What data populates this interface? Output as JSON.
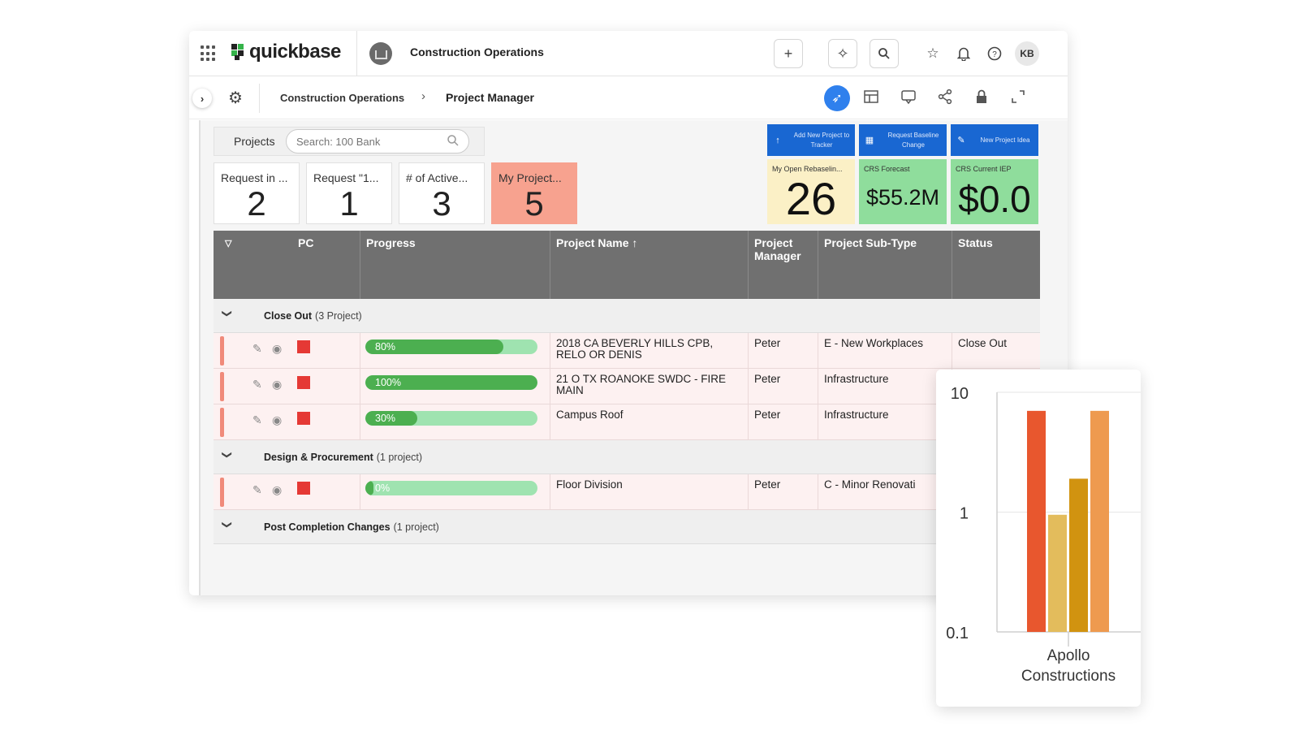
{
  "topbar": {
    "logo_text": "quickbase",
    "app_name": "Construction Operations",
    "user_initials": "KB",
    "icons": [
      "apps-grid-icon",
      "plus-icon",
      "ai-sparkle-icon",
      "search-icon",
      "star-icon",
      "bell-icon",
      "help-icon"
    ]
  },
  "subbar": {
    "breadcrumb_app": "Construction Operations",
    "breadcrumb_separator": "›",
    "breadcrumb_page": "Project Manager"
  },
  "search": {
    "tab_label": "Projects",
    "placeholder": "Search: 100 Bank"
  },
  "kpis": [
    {
      "label": "Request in ...",
      "value": "2"
    },
    {
      "label": "Request \"1...",
      "value": "1"
    },
    {
      "label": "# of Active...",
      "value": "3"
    },
    {
      "label": "My Project...",
      "value": "5",
      "highlight": "#f7a28f"
    }
  ],
  "actions": [
    {
      "label": "Add New Project to Tracker",
      "icon": "arrow-up-icon"
    },
    {
      "label": "Request Baseline Change",
      "icon": "table-icon"
    },
    {
      "label": "New Project Idea",
      "icon": "lightbulb-icon"
    }
  ],
  "metrics": [
    {
      "label": "My Open Rebaselin...",
      "value": "26",
      "color": "#fbf0c6"
    },
    {
      "label": "CRS Forecast",
      "value": "$55.2M",
      "color": "#8fdd9c"
    },
    {
      "label": "CRS Current IEP",
      "value": "$0.0",
      "color": "#8fdd9c"
    }
  ],
  "table": {
    "columns": [
      "PC",
      "Progress",
      "Project Name ↑",
      "Project Manager",
      "Project Sub-Type",
      "Status"
    ],
    "groups": [
      {
        "name": "Close Out",
        "count": "(3 Project)",
        "rows": [
          {
            "progress_label": "80%",
            "progress": 0.8,
            "name": "2018 CA BEVERLY HILLS CPB, RELO OR DENIS",
            "manager": "Peter",
            "subtype": "E - New Workplaces",
            "status": "Close Out"
          },
          {
            "progress_label": "100%",
            "progress": 1.0,
            "name": "21 O TX ROANOKE SWDC - FIRE MAIN",
            "manager": "Peter",
            "subtype": "Infrastructure",
            "status": ""
          },
          {
            "progress_label": "30%",
            "progress": 0.3,
            "name": "Campus Roof",
            "manager": "Peter",
            "subtype": "Infrastructure",
            "status": ""
          }
        ]
      },
      {
        "name": "Design & Procurement",
        "count": "(1 project)",
        "rows": [
          {
            "progress_label": "0%",
            "progress": 0.0,
            "name": "Floor Division",
            "manager": "Peter",
            "subtype": "C - Minor Renovati",
            "status": ""
          }
        ]
      },
      {
        "name": "Post Completion Changes",
        "count": "(1 project)",
        "rows": []
      }
    ]
  },
  "colors": {
    "accent_blue": "#1967d2",
    "progress_fill": "#4caf50",
    "progress_track": "#9fe3b0",
    "row_flag": "#e53935"
  },
  "chart_data": {
    "type": "bar",
    "categories": [
      "Apollo Constructions"
    ],
    "xlabel": "",
    "ylabel": "",
    "yscale": "log",
    "ylim": [
      0.1,
      10
    ],
    "yticks": [
      "10",
      "1",
      "0.1"
    ],
    "grid": true,
    "series": [
      {
        "values": [
          7
        ],
        "color": "#e8572e"
      },
      {
        "values": [
          0.95
        ],
        "color": "#e3bc5c"
      },
      {
        "values": [
          1.9
        ],
        "color": "#d19310"
      },
      {
        "values": [
          7
        ],
        "color": "#ee9a4f"
      }
    ]
  }
}
